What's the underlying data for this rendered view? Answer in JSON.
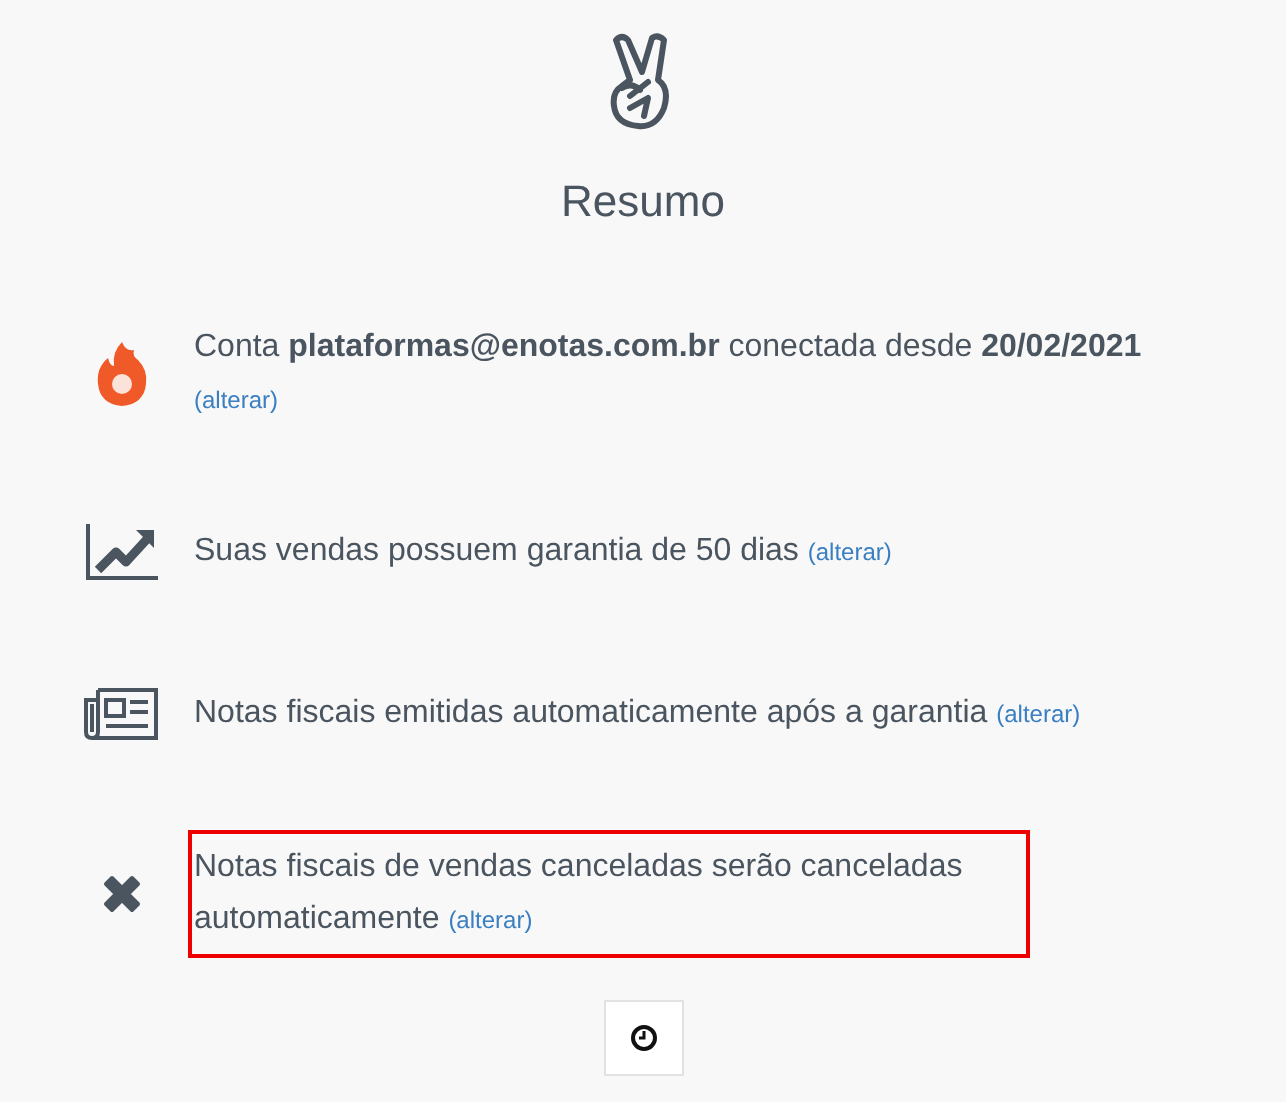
{
  "title": "Resumo",
  "items": [
    {
      "kind": "flame",
      "text": "Conta **plataformas@enotas.com.br** conectada desde **20/02/2021**",
      "link": "(alterar)",
      "highlighted": false
    },
    {
      "kind": "chart",
      "text": "Suas vendas possuem garantia de 50 dias",
      "link": "(alterar)",
      "highlighted": false
    },
    {
      "kind": "newspaper",
      "text": "Notas fiscais emitidas automaticamente após a garantia",
      "link": "(alterar)",
      "highlighted": false
    },
    {
      "kind": "cross",
      "text": "Notas fiscais de vendas canceladas serão canceladas automaticamente",
      "link": "(alterar)",
      "highlighted": true
    }
  ]
}
